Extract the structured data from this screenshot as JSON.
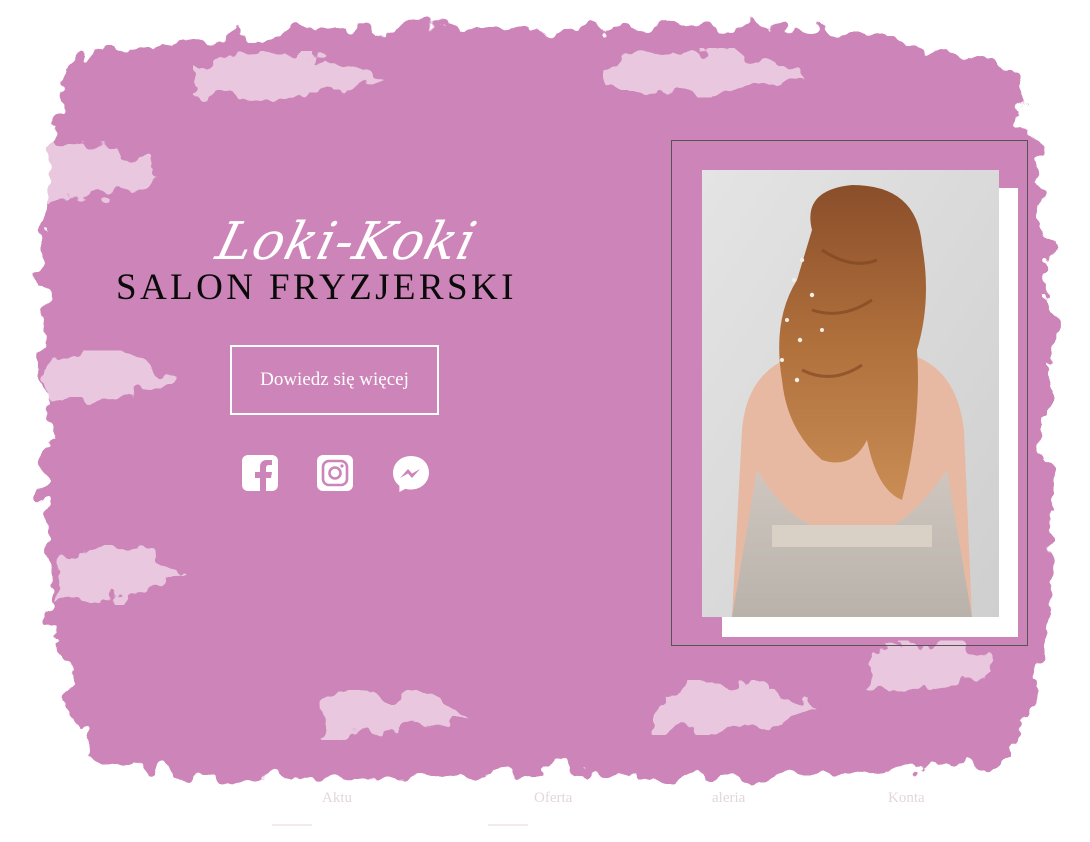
{
  "brand": {
    "script_name": "Loki-Koki",
    "headline": "SALON FRYZJERSKI"
  },
  "cta": {
    "label": "Dowiedz się więcej"
  },
  "social": [
    "facebook-icon",
    "instagram-icon",
    "messenger-icon"
  ],
  "nav": {
    "items": [
      {
        "label": "Aktu"
      },
      {
        "label": "Oferta"
      },
      {
        "label": "aleria"
      },
      {
        "label": "Konta"
      }
    ]
  },
  "colors": {
    "brush": "#cd84b8",
    "text_dark": "#0a0a0a",
    "white": "#ffffff"
  }
}
